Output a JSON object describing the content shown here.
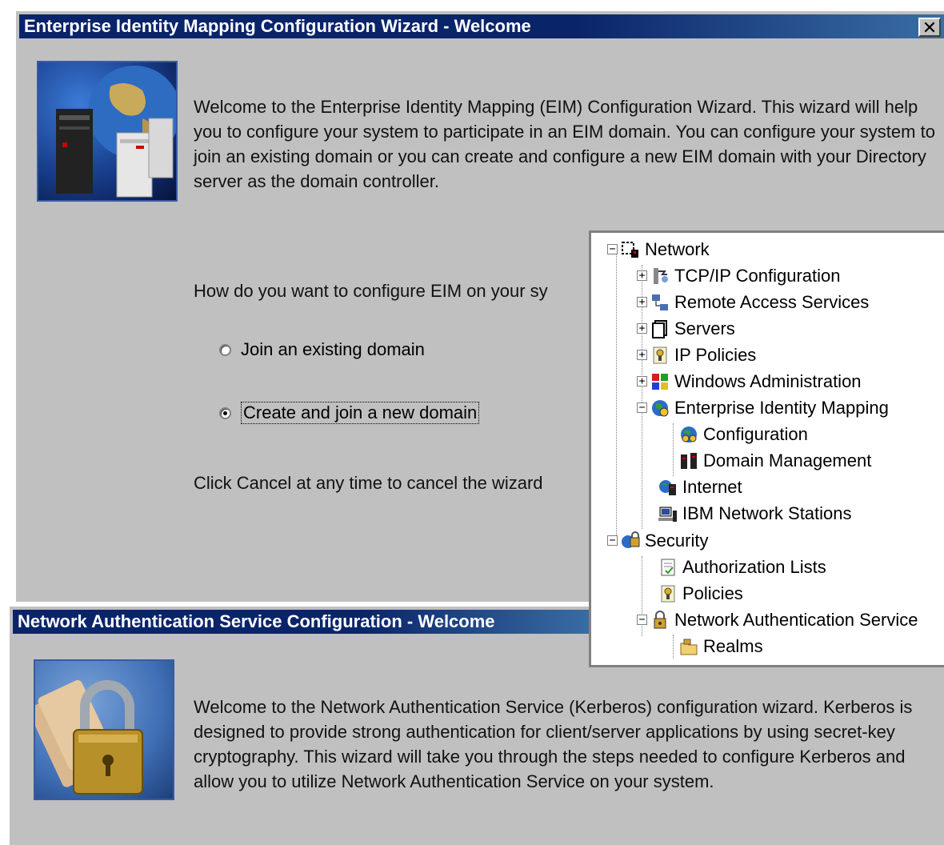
{
  "eim_wizard": {
    "title": "Enterprise Identity Mapping Configuration Wizard - Welcome",
    "close_label": "✕",
    "intro": "Welcome to the Enterprise Identity Mapping (EIM) Configuration Wizard. This wizard will help you to configure your system to participate in an EIM domain.  You can configure your system to join an existing domain or  you can create and configure a new EIM domain with your Directory server as the domain controller.",
    "question": "How do you want to configure EIM on your sy",
    "options": [
      {
        "label": "Join an existing domain",
        "selected": false
      },
      {
        "label": "Create and join a new domain",
        "selected": true
      }
    ],
    "cancel_note": "Click Cancel at any time to cancel the wizard"
  },
  "tree": {
    "items": [
      {
        "label": "Network",
        "expander": "−",
        "icon": "network-icon"
      },
      {
        "label": "TCP/IP Configuration",
        "expander": "+",
        "icon": "tcpip-icon"
      },
      {
        "label": "Remote Access Services",
        "expander": "+",
        "icon": "remote-access-icon"
      },
      {
        "label": "Servers",
        "expander": "+",
        "icon": "servers-icon"
      },
      {
        "label": "IP Policies",
        "expander": "+",
        "icon": "ip-policies-icon"
      },
      {
        "label": "Windows Administration",
        "expander": "+",
        "icon": "windows-admin-icon"
      },
      {
        "label": "Enterprise Identity Mapping",
        "expander": "−",
        "icon": "eim-icon"
      },
      {
        "label": "Configuration",
        "expander": "",
        "icon": "configuration-icon"
      },
      {
        "label": "Domain Management",
        "expander": "",
        "icon": "domain-management-icon"
      },
      {
        "label": "Internet",
        "expander": "",
        "icon": "internet-icon"
      },
      {
        "label": "IBM Network Stations",
        "expander": "",
        "icon": "network-stations-icon"
      },
      {
        "label": "Security",
        "expander": "−",
        "icon": "security-icon"
      },
      {
        "label": "Authorization Lists",
        "expander": "",
        "icon": "authorization-lists-icon"
      },
      {
        "label": "Policies",
        "expander": "",
        "icon": "policies-icon"
      },
      {
        "label": "Network Authentication Service",
        "expander": "−",
        "icon": "nas-icon"
      },
      {
        "label": "Realms",
        "expander": "",
        "icon": "realms-icon"
      }
    ]
  },
  "nas_wizard": {
    "title": "Network Authentication Service Configuration - Welcome",
    "intro": "Welcome to the Network Authentication Service (Kerberos) configuration wizard. Kerberos is designed to provide strong authentication for client/server applications by using secret-key cryptography. This wizard will take you through the steps needed to configure Kerberos and allow you to utilize Network Authentication Service on your system."
  },
  "colors": {
    "title_bar": "#0a246a",
    "dialog_bg": "#c0c0c0"
  }
}
